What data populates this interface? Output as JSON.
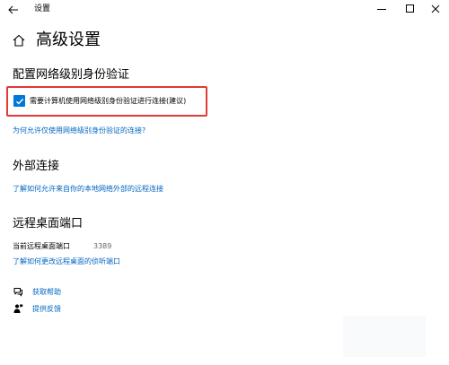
{
  "window": {
    "title": "设置",
    "back_icon": "back-arrow-icon",
    "minimize_icon": "minimize-icon",
    "maximize_icon": "maximize-icon",
    "close_icon": "close-icon"
  },
  "header": {
    "home_icon": "home-icon",
    "title": "高级设置"
  },
  "network_auth": {
    "heading": "配置网络级别身份验证",
    "checkbox_label": "需要计算机使用网络级别身份验证进行连接(建议)",
    "checked": true,
    "highlight_color": "#e03b35",
    "link": "为何允许仅使用网络级别身份验证的连接?"
  },
  "external": {
    "heading": "外部连接",
    "link": "了解如何允许来自你的本地网络外部的远程连接"
  },
  "rdp_port": {
    "heading": "远程桌面端口",
    "label": "当前远程桌面端口",
    "value": "3389",
    "link": "了解如何更改远程桌面的侦听端口"
  },
  "help": {
    "get_help": "获取帮助",
    "feedback": "提供反馈",
    "get_help_icon": "chat-help-icon",
    "feedback_icon": "feedback-person-icon"
  },
  "colors": {
    "accent": "#0078d7",
    "link": "#0067c0"
  }
}
